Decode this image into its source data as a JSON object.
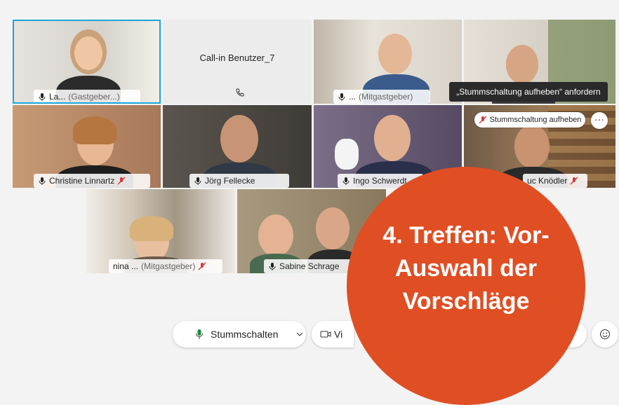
{
  "participants": [
    {
      "name": "La...",
      "role": "(Gastgeber...)"
    },
    {
      "name": "Call-in Benutzer_7"
    },
    {
      "name": "...",
      "role": "(Mitgastgeber)"
    },
    {
      "name": "Christine Linnartz"
    },
    {
      "name": "Jörg Fellecke"
    },
    {
      "name": "Ingo Schwerdt"
    },
    {
      "name": "uc Knödler"
    },
    {
      "name": "nina ...",
      "role": "(Mitgastgeber)"
    },
    {
      "name": "Sabine Schrage"
    }
  ],
  "tooltip": "„Stummschaltung aufheben“ anfordern",
  "unmute_button": "Stummschaltung aufheben",
  "toolbar": {
    "mute_label": "Stummschalten",
    "video_label": "Vi"
  },
  "overlay": {
    "line1": "4. Treffen: Vor-",
    "line2": "Auswahl der",
    "line3": "Vorschläge",
    "color": "#e04e24"
  }
}
